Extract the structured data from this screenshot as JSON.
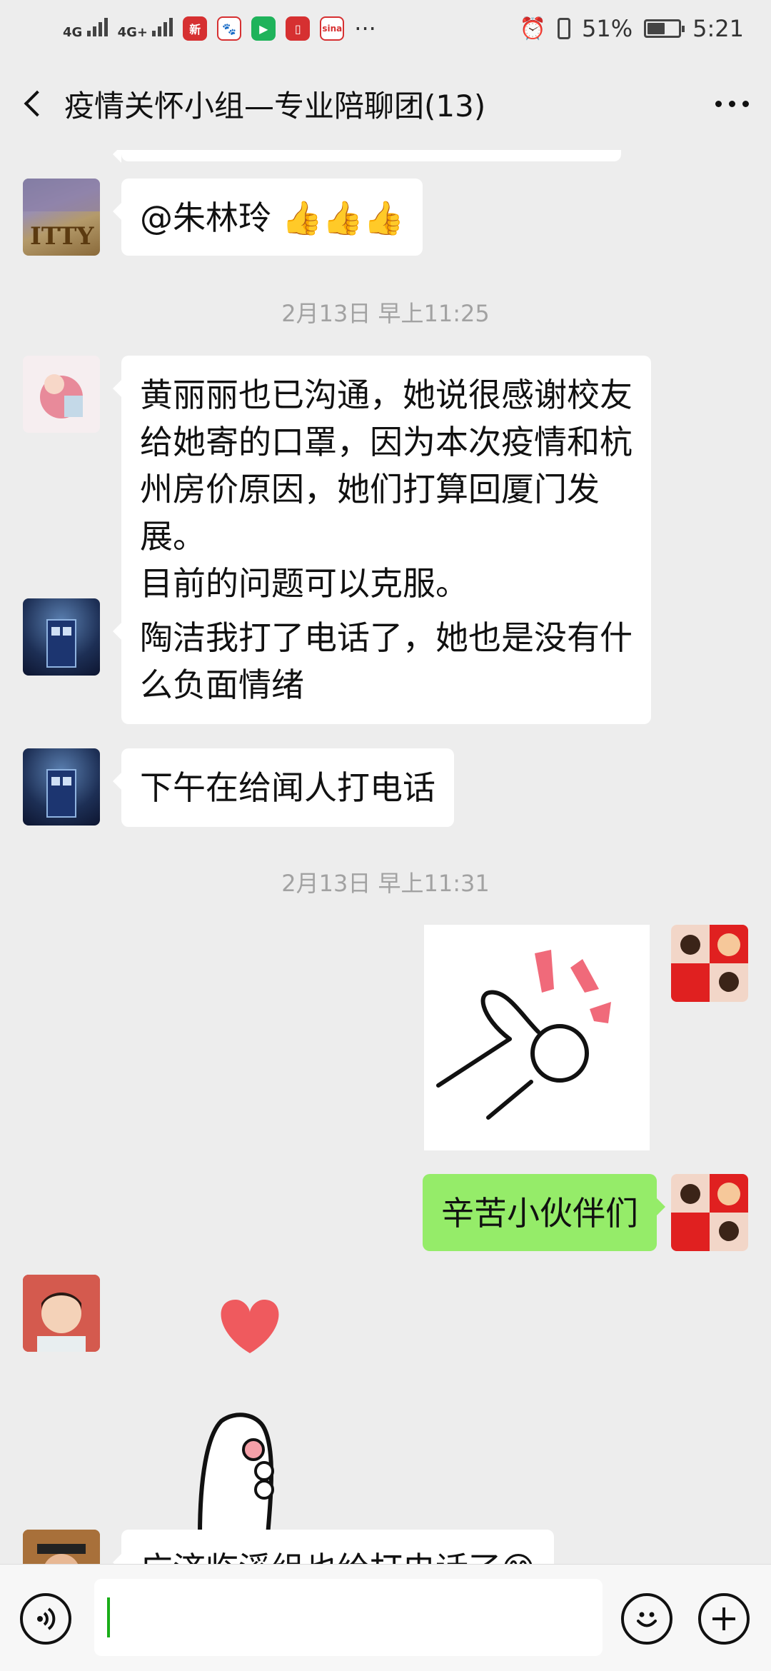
{
  "status_bar": {
    "network_1": "4G",
    "network_2": "4G+",
    "more": "···",
    "battery_percent": "51%",
    "time": "5:21",
    "battery_level": 0.51,
    "apps": [
      "news-app-icon",
      "baidu-icon",
      "video-app-icon",
      "reader-app-icon",
      "sina-icon"
    ]
  },
  "header": {
    "title": "疫情关怀小组—专业陪聊团(13)",
    "back_icon": "chevron-left-icon",
    "more_icon": "more-dots-icon"
  },
  "messages": [
    {
      "side": "left",
      "type": "text",
      "text": "@朱林玲 👍👍👍"
    },
    {
      "type": "timestamp",
      "text": "2月13日 早上11:25"
    },
    {
      "side": "left",
      "type": "text",
      "lines": [
        "黄丽丽也已沟通，她说很感谢校友",
        "给她寄的口罩，因为本次疫情和杭",
        "州房价原因，她们打算回厦门发展。",
        "目前的问题可以克服。"
      ]
    },
    {
      "side": "left",
      "type": "text",
      "lines": [
        "陶洁我打了电话了，她也是没有什",
        "么负面情绪"
      ]
    },
    {
      "side": "left",
      "type": "text",
      "text": "下午在给闻人打电话"
    },
    {
      "type": "timestamp",
      "text": "2月13日 早上11:31"
    },
    {
      "side": "right",
      "type": "sticker",
      "sticker": "ok-hand-sticker"
    },
    {
      "side": "right",
      "type": "text",
      "text": "辛苦小伙伴们"
    },
    {
      "side": "left",
      "type": "sticker",
      "sticker": "heart-paw-sticker"
    },
    {
      "side": "left",
      "type": "text",
      "text": "广济临溪组也给打电话了😊"
    }
  ],
  "input_bar": {
    "voice_icon": "voice-icon",
    "emoji_icon": "emoji-icon",
    "plus_icon": "plus-icon"
  },
  "colors": {
    "background": "#ededed",
    "bubble_self": "#95ec69",
    "bubble_other": "#ffffff",
    "timestamp": "#a2a2a2"
  }
}
